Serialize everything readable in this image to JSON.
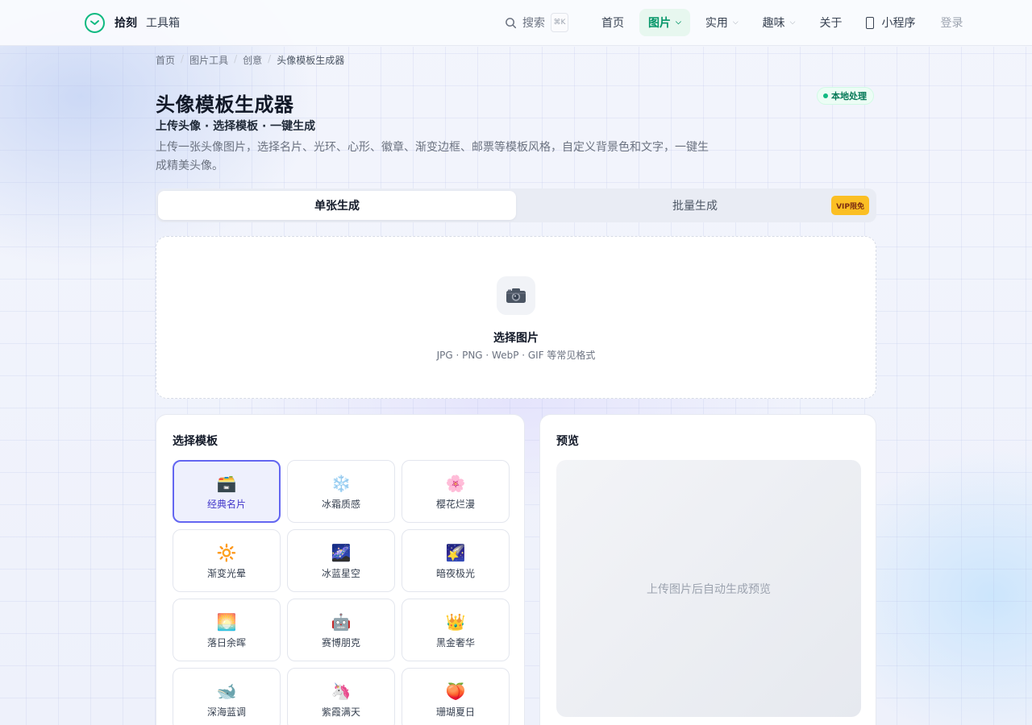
{
  "header": {
    "brand": "拾刻",
    "brand_sub": "工具箱",
    "search_label": "搜索",
    "search_shortcut": "⌘K",
    "nav": [
      {
        "label": "首页"
      },
      {
        "label": "图片"
      },
      {
        "label": "实用"
      },
      {
        "label": "趣味"
      },
      {
        "label": "关于"
      }
    ],
    "mini_program": "小程序",
    "login": "登录"
  },
  "breadcrumb": [
    "首页",
    "图片工具",
    "创意",
    "头像模板生成器"
  ],
  "page": {
    "title": "头像模板生成器",
    "badge": "本地处理",
    "subtitle": "上传头像 · 选择模板 · 一键生成",
    "description": "上传一张头像图片，选择名片、光环、心形、徽章、渐变边框、邮票等模板风格，自定义背景色和文字，一键生成精美头像。"
  },
  "tabs": {
    "single": "单张生成",
    "batch": "批量生成",
    "vip": "VIP限免"
  },
  "upload": {
    "icon": "camera-icon",
    "title": "选择图片",
    "hint": "JPG · PNG · WebP · GIF 等常见格式"
  },
  "templates": {
    "title": "选择模板",
    "items": [
      {
        "icon": "🗃️",
        "label": "经典名片"
      },
      {
        "icon": "❄️",
        "label": "冰霜质感"
      },
      {
        "icon": "🌸",
        "label": "樱花烂漫"
      },
      {
        "icon": "🔆",
        "label": "渐变光晕"
      },
      {
        "icon": "🌌",
        "label": "冰蓝星空"
      },
      {
        "icon": "🌠",
        "label": "暗夜极光"
      },
      {
        "icon": "🌅",
        "label": "落日余晖"
      },
      {
        "icon": "🤖",
        "label": "赛博朋克"
      },
      {
        "icon": "👑",
        "label": "黑金奢华"
      },
      {
        "icon": "🐋",
        "label": "深海蓝调"
      },
      {
        "icon": "🦄",
        "label": "紫霞满天"
      },
      {
        "icon": "🍑",
        "label": "珊瑚夏日"
      }
    ]
  },
  "preview": {
    "title": "预览",
    "placeholder": "上传图片后自动生成预览"
  },
  "colors": {
    "accent_green": "#10b981",
    "selected_border": "#6366f1",
    "vip_badge": "#fbbf24"
  }
}
